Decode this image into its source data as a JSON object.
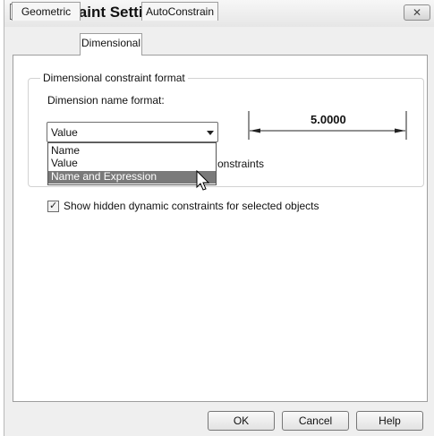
{
  "window": {
    "title": "Constraint Settings",
    "close_glyph": "✕"
  },
  "tabs": [
    {
      "label": "Geometric",
      "active": false
    },
    {
      "label": "Dimensional",
      "active": true
    },
    {
      "label": "AutoConstrain",
      "active": false
    }
  ],
  "dimensional": {
    "group_title": "Dimensional constraint format",
    "name_format_label": "Dimension name format:",
    "name_format_value": "Value",
    "name_format_options": [
      "Name",
      "Value",
      "Name and Expression"
    ],
    "highlighted_option": "Name and Expression",
    "partial_hidden_text": "onstraints",
    "preview_value": "5.0000"
  },
  "show_hidden": {
    "checked": true,
    "label": "Show hidden dynamic constraints for selected objects"
  },
  "buttons": {
    "ok": "OK",
    "cancel": "Cancel",
    "help": "Help"
  },
  "icons": {
    "app": "autocad-dimension-icon",
    "close": "close-icon",
    "dropdown": "chevron-down-icon",
    "cursor": "mouse-pointer-icon"
  }
}
